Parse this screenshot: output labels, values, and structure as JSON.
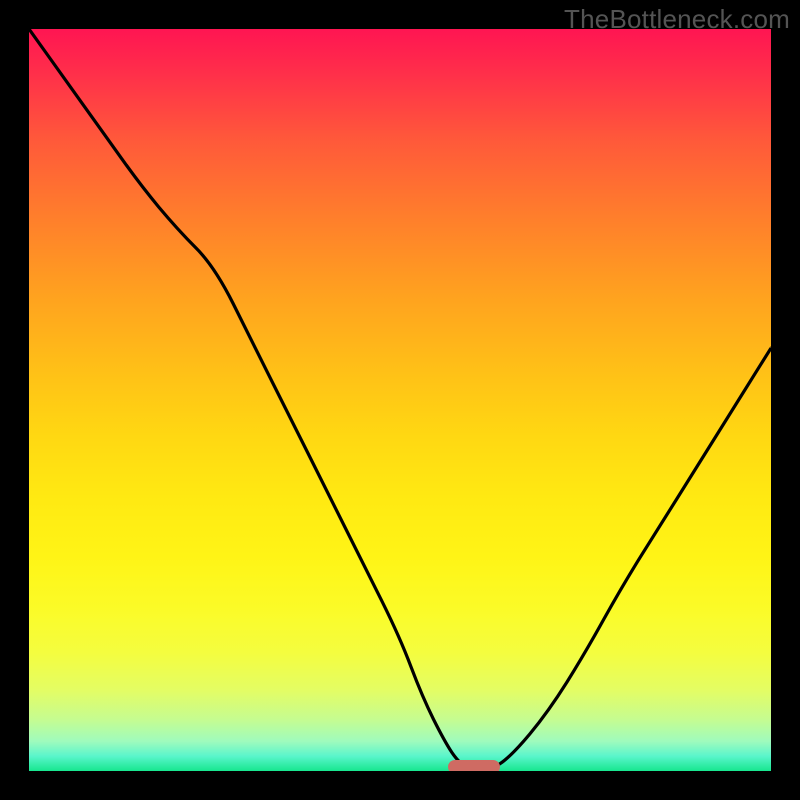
{
  "watermark": "TheBottleneck.com",
  "chart_data": {
    "type": "line",
    "title": "",
    "xlabel": "",
    "ylabel": "",
    "xlim": [
      0,
      100
    ],
    "ylim": [
      0,
      100
    ],
    "grid": false,
    "legend": false,
    "series": [
      {
        "name": "bottleneck-curve",
        "x": [
          0,
          5,
          10,
          15,
          20,
          25,
          30,
          35,
          40,
          45,
          50,
          53,
          56,
          58,
          60,
          62,
          65,
          70,
          75,
          80,
          85,
          90,
          95,
          100
        ],
        "values": [
          100,
          93,
          86,
          79,
          73,
          68,
          58,
          48,
          38,
          28,
          18,
          10,
          4,
          1,
          0,
          0,
          2,
          8,
          16,
          25,
          33,
          41,
          49,
          57
        ]
      }
    ],
    "annotations": [
      {
        "name": "optimal-marker",
        "x": 60,
        "y": 0.5,
        "width": 7,
        "color": "#cf6b63"
      }
    ],
    "background_gradient": {
      "top": "#ff1552",
      "mid": "#ffe912",
      "bottom": "#17e78f"
    }
  },
  "colors": {
    "frame": "#000000",
    "watermark": "#545454",
    "curve": "#000000",
    "marker": "#cf6b63"
  }
}
